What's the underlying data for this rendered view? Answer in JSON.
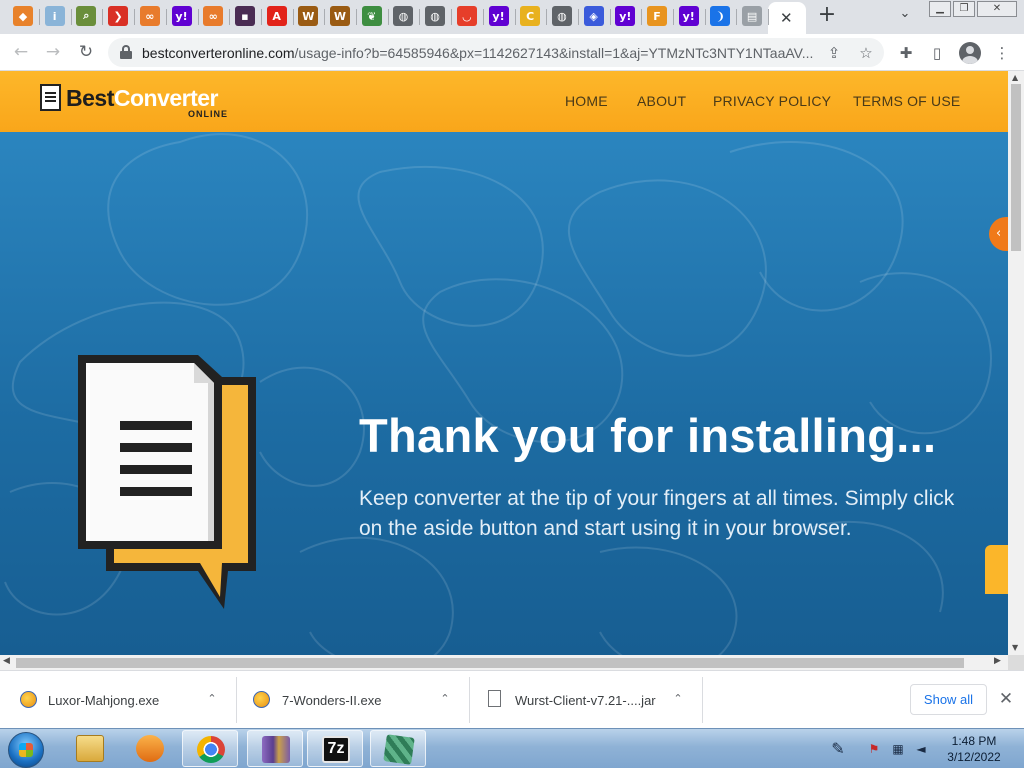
{
  "browser": {
    "tabs": [
      {
        "icon": "diamond-orange-icon",
        "color": "#e8822b",
        "glyph": "◆"
      },
      {
        "icon": "info-icon",
        "color": "#8ab4d8",
        "glyph": "i"
      },
      {
        "icon": "magnifier-doc-icon",
        "color": "#6a8e3b",
        "glyph": "⌕"
      },
      {
        "icon": "chevron-red-icon",
        "color": "#d93025",
        "glyph": "❯"
      },
      {
        "icon": "binoculars-icon",
        "color": "#e87b2c",
        "glyph": "∞"
      },
      {
        "icon": "yahoo-icon",
        "color": "#6001d2",
        "glyph": "y!"
      },
      {
        "icon": "binoculars-icon",
        "color": "#e87b2c",
        "glyph": "∞"
      },
      {
        "icon": "dark-square-icon",
        "color": "#4a2c53",
        "glyph": "▪"
      },
      {
        "icon": "adobe-red-icon",
        "color": "#e2231a",
        "glyph": "A"
      },
      {
        "icon": "w-icon",
        "color": "#9a5b13",
        "glyph": "W"
      },
      {
        "icon": "w-icon",
        "color": "#9a5b13",
        "glyph": "W"
      },
      {
        "icon": "leaf-icon",
        "color": "#3e8e41",
        "glyph": "❦"
      },
      {
        "icon": "globe-icon",
        "color": "#5f6368",
        "glyph": "◍"
      },
      {
        "icon": "globe-icon",
        "color": "#5f6368",
        "glyph": "◍"
      },
      {
        "icon": "red-shopping-icon",
        "color": "#e63e2a",
        "glyph": "◡"
      },
      {
        "icon": "yahoo-icon",
        "color": "#6001d2",
        "glyph": "y!"
      },
      {
        "icon": "yellow-c-icon",
        "color": "#e8b11f",
        "glyph": "C"
      },
      {
        "icon": "globe-icon",
        "color": "#5f6368",
        "glyph": "◍"
      },
      {
        "icon": "stack-icon",
        "color": "#3b5bdb",
        "glyph": "◈"
      },
      {
        "icon": "yahoo-icon",
        "color": "#6001d2",
        "glyph": "y!"
      },
      {
        "icon": "fox-icon",
        "color": "#e8941f",
        "glyph": "F"
      },
      {
        "icon": "yahoo-icon",
        "color": "#6001d2",
        "glyph": "y!"
      },
      {
        "icon": "paren-icon",
        "color": "#1a73e8",
        "glyph": "❩"
      },
      {
        "icon": "document-icon",
        "color": "#9aa0a6",
        "glyph": "▤"
      }
    ],
    "active_tab_close": "✕",
    "new_tab": "+",
    "tab_search": "⌄",
    "window_controls": [
      "▁",
      "❐",
      "✕"
    ],
    "nav": {
      "back": "←",
      "forward": "→",
      "reload": "↻"
    },
    "url_host": "bestconverteronline.com",
    "url_path": "/usage-info?b=64585946&px=1142627143&install=1&aj=YTMzNTc3NTY1NTaaAV...",
    "toolbar_icons": {
      "share": "⇪",
      "star": "☆",
      "extensions": "✚",
      "sidepanel": "▯",
      "menu": "⋮"
    }
  },
  "site": {
    "logo_best": "Best",
    "logo_converter": "Converter",
    "logo_online": "ONLINE",
    "nav": [
      "HOME",
      "ABOUT",
      "PRIVACY POLICY",
      "TERMS OF USE"
    ],
    "hero_title": "Thank you for installing...",
    "hero_subtitle": "Keep converter at the tip of your fingers at all times. Simply click on the aside button and start using it in your browser.",
    "side_tab_arrow": "‹",
    "colors": {
      "header": "#f9a61a",
      "hero": "#1d6ca3",
      "side_tab": "#f07a1a"
    }
  },
  "downloads": {
    "items": [
      {
        "name": "Luxor-Mahjong.exe",
        "chevron": "⌃"
      },
      {
        "name": "7-Wonders-II.exe",
        "chevron": "⌃"
      },
      {
        "name": "Wurst-Client-v7.21-....jar",
        "chevron": "⌃"
      }
    ],
    "show_all": "Show all",
    "close": "✕"
  },
  "taskbar": {
    "apps": [
      {
        "name": "windows-explorer",
        "color": "#e7c15a"
      },
      {
        "name": "media-player",
        "color": "#f08a24"
      },
      {
        "name": "chrome",
        "color": "#db4437"
      },
      {
        "name": "winrar",
        "color": "#7a5ca8"
      },
      {
        "name": "7zip",
        "color": "#222222"
      },
      {
        "name": "package-app",
        "color": "#4a9a6e"
      }
    ],
    "app_7z_label": "7z",
    "time": "1:48 PM",
    "date": "3/12/2022"
  }
}
